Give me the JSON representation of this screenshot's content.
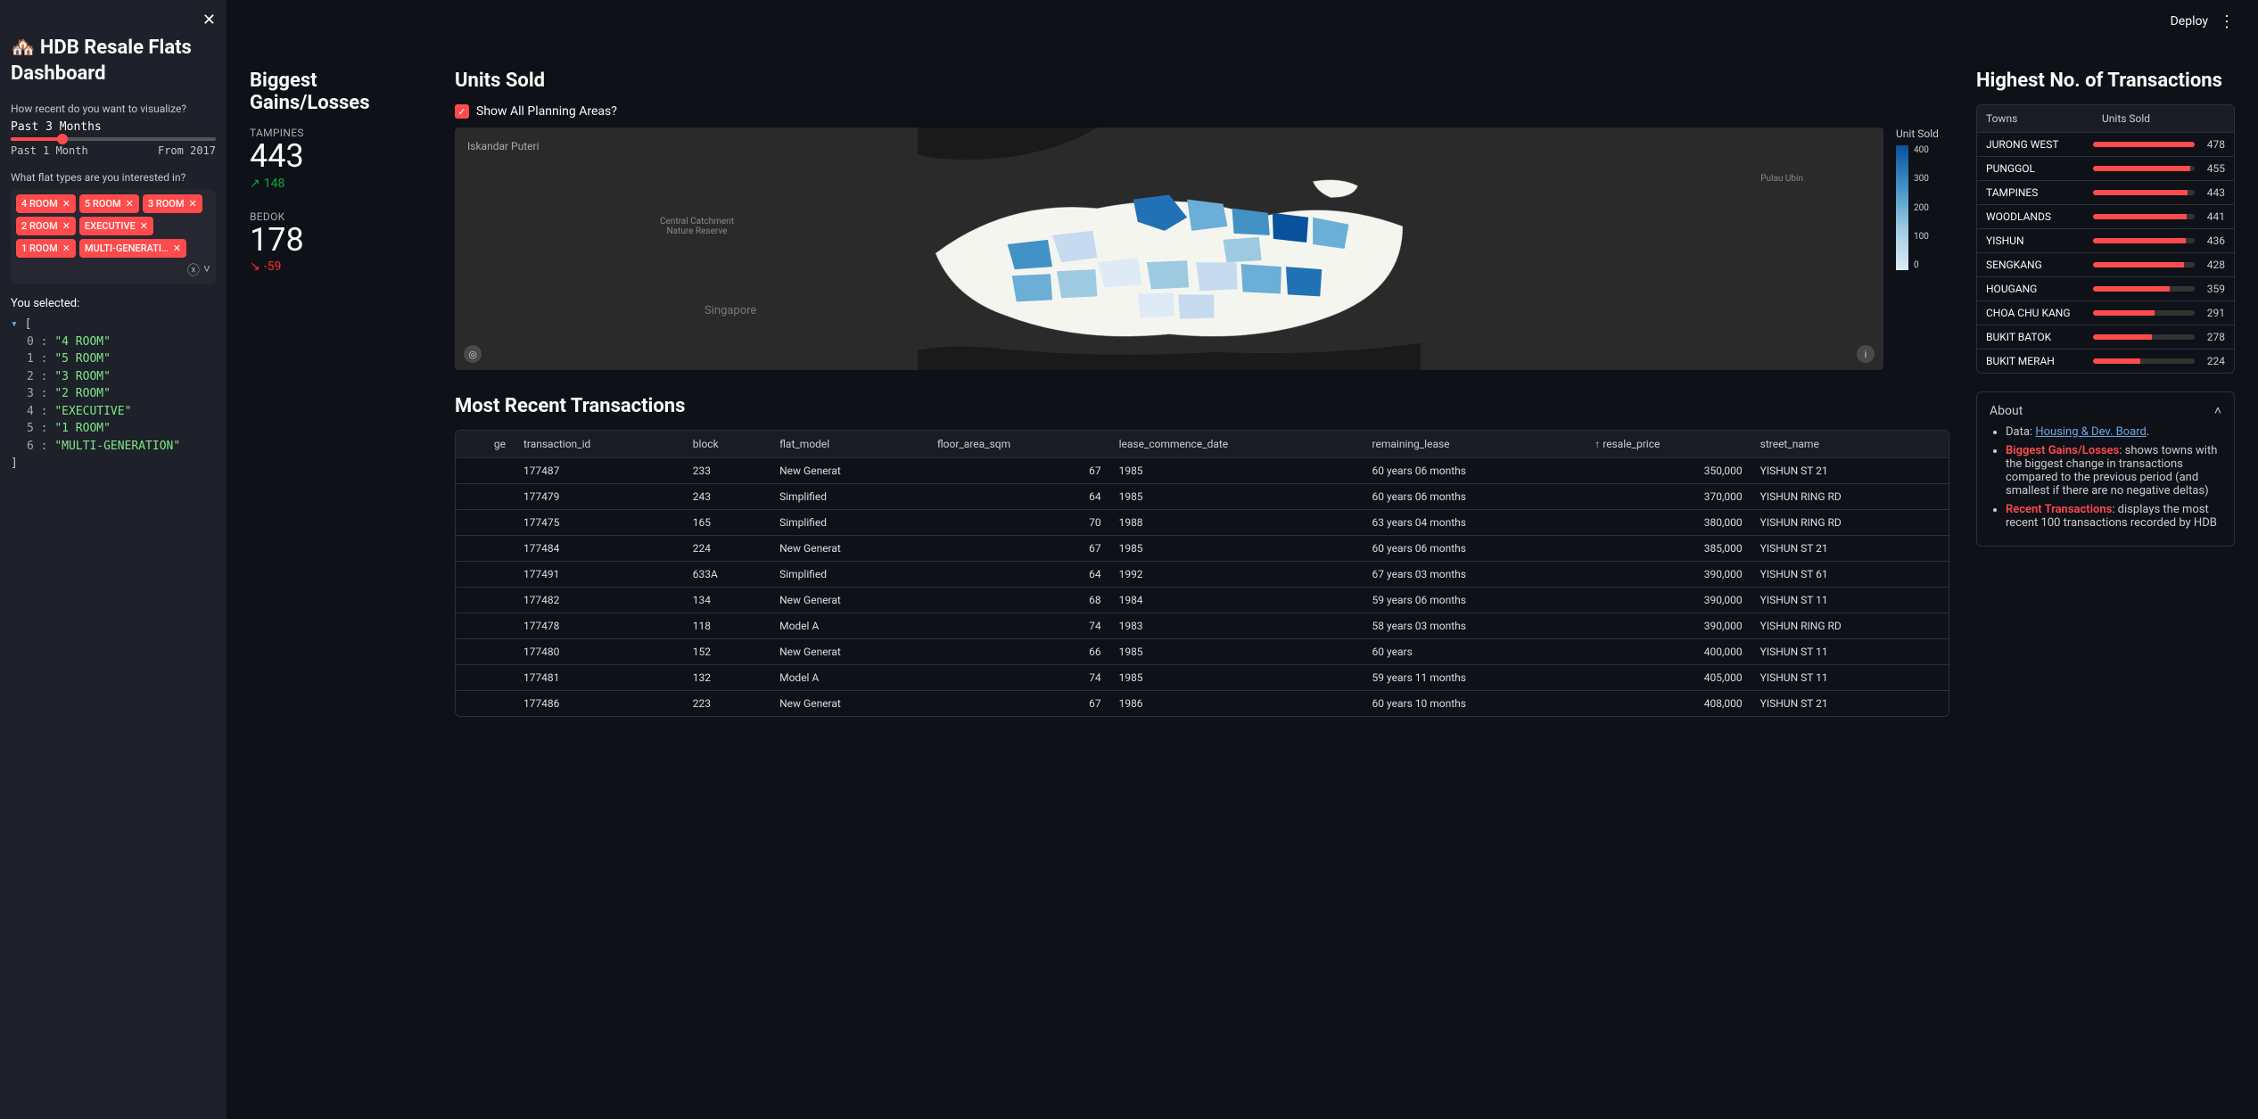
{
  "sidebar": {
    "title": "🏘️ HDB Resale Flats Dashboard",
    "slider_label": "How recent do you want to visualize?",
    "slider_value": "Past 3 Months",
    "slider_min": "Past 1 Month",
    "slider_max": "From 2017",
    "multiselect_label": "What flat types are you interested in?",
    "chips": [
      "4 ROOM",
      "5 ROOM",
      "3 ROOM",
      "2 ROOM",
      "EXECUTIVE",
      "1 ROOM",
      "MULTI-GENERATI…"
    ],
    "selected_label": "You selected:",
    "selected_json": [
      "\"4 ROOM\"",
      "\"5 ROOM\"",
      "\"3 ROOM\"",
      "\"2 ROOM\"",
      "\"EXECUTIVE\"",
      "\"1 ROOM\"",
      "\"MULTI-GENERATION\""
    ]
  },
  "topbar": {
    "deploy": "Deploy"
  },
  "gains": {
    "heading": "Biggest Gains/Losses",
    "items": [
      {
        "town": "TAMPINES",
        "value": "443",
        "delta": "148",
        "dir": "up"
      },
      {
        "town": "BEDOK",
        "value": "178",
        "delta": "-59",
        "dir": "down"
      }
    ]
  },
  "map": {
    "heading": "Units Sold",
    "checkbox": "Show All Planning Areas?",
    "legend_title": "Unit Sold",
    "legend_ticks": [
      "400",
      "300",
      "200",
      "100",
      "0"
    ],
    "labels": {
      "iskandar": "Iskandar Puteri",
      "singapore": "Singapore",
      "catchment": "Central Catchment\nNature Reserve",
      "ubin": "Pulau Ubin"
    }
  },
  "rank": {
    "heading": "Highest No. of Transactions",
    "th_town": "Towns",
    "th_units": "Units Sold",
    "rows": [
      {
        "town": "JURONG WEST",
        "val": 478
      },
      {
        "town": "PUNGGOL",
        "val": 455
      },
      {
        "town": "TAMPINES",
        "val": 443
      },
      {
        "town": "WOODLANDS",
        "val": 441
      },
      {
        "town": "YISHUN",
        "val": 436
      },
      {
        "town": "SENGKANG",
        "val": 428
      },
      {
        "town": "HOUGANG",
        "val": 359
      },
      {
        "town": "CHOA CHU KANG",
        "val": 291
      },
      {
        "town": "BUKIT BATOK",
        "val": 278
      },
      {
        "town": "BUKIT MERAH",
        "val": 224
      }
    ],
    "max": 478
  },
  "about": {
    "heading": "About",
    "data_label": "Data: ",
    "data_link": "Housing & Dev. Board",
    "b1_strong": "Biggest Gains/Losses",
    "b1_text": ": shows towns with the biggest change in transactions compared to the previous period (and smallest if there are no negative deltas)",
    "b2_strong": "Recent Transactions",
    "b2_text": ": displays the most recent 100 transactions recorded by HDB"
  },
  "recent": {
    "heading": "Most Recent Transactions",
    "columns": [
      "ge",
      "transaction_id",
      "block",
      "flat_model",
      "floor_area_sqm",
      "lease_commence_date",
      "remaining_lease",
      "↑ resale_price",
      "street_name"
    ],
    "rows": [
      [
        "",
        "177487",
        "233",
        "New Generat",
        "67",
        "1985",
        "60 years 06 months",
        "350,000",
        "YISHUN ST 21"
      ],
      [
        "",
        "177479",
        "243",
        "Simplified",
        "64",
        "1985",
        "60 years 06 months",
        "370,000",
        "YISHUN RING RD"
      ],
      [
        "",
        "177475",
        "165",
        "Simplified",
        "70",
        "1988",
        "63 years 04 months",
        "380,000",
        "YISHUN RING RD"
      ],
      [
        "",
        "177484",
        "224",
        "New Generat",
        "67",
        "1985",
        "60 years 06 months",
        "385,000",
        "YISHUN ST 21"
      ],
      [
        "",
        "177491",
        "633A",
        "Simplified",
        "64",
        "1992",
        "67 years 03 months",
        "390,000",
        "YISHUN ST 61"
      ],
      [
        "",
        "177482",
        "134",
        "New Generat",
        "68",
        "1984",
        "59 years 06 months",
        "390,000",
        "YISHUN ST 11"
      ],
      [
        "",
        "177478",
        "118",
        "Model A",
        "74",
        "1983",
        "58 years 03 months",
        "390,000",
        "YISHUN RING RD"
      ],
      [
        "",
        "177480",
        "152",
        "New Generat",
        "66",
        "1985",
        "60 years",
        "400,000",
        "YISHUN ST 11"
      ],
      [
        "",
        "177481",
        "132",
        "Model A",
        "74",
        "1985",
        "59 years 11 months",
        "405,000",
        "YISHUN ST 11"
      ],
      [
        "",
        "177486",
        "223",
        "New Generat",
        "67",
        "1986",
        "60 years 10 months",
        "408,000",
        "YISHUN ST 21"
      ]
    ]
  },
  "chart_data": {
    "type": "bar",
    "title": "Highest No. of Transactions",
    "xlabel": "Units Sold",
    "ylabel": "Towns",
    "categories": [
      "JURONG WEST",
      "PUNGGOL",
      "TAMPINES",
      "WOODLANDS",
      "YISHUN",
      "SENGKANG",
      "HOUGANG",
      "CHOA CHU KANG",
      "BUKIT BATOK",
      "BUKIT MERAH"
    ],
    "values": [
      478,
      455,
      443,
      441,
      436,
      428,
      359,
      291,
      278,
      224
    ],
    "ylim": [
      0,
      478
    ]
  }
}
